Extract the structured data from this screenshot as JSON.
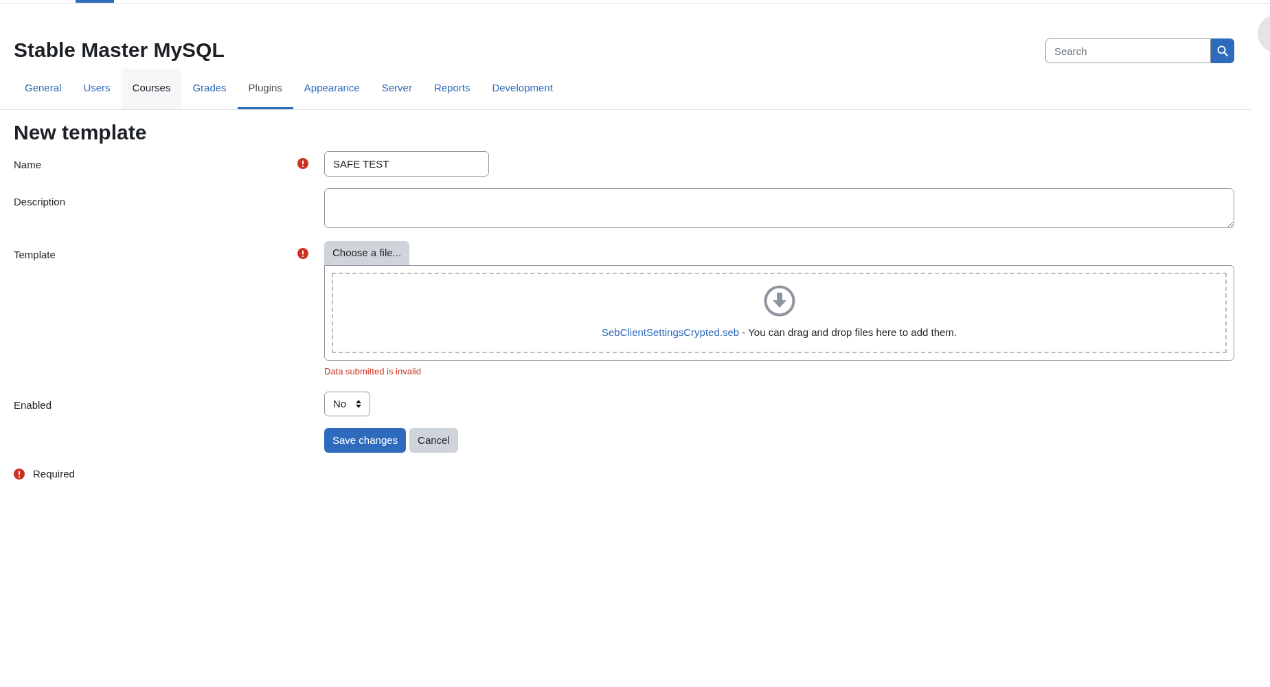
{
  "site_title": "Stable Master MySQL",
  "search": {
    "placeholder": "Search"
  },
  "tabs": [
    {
      "label": "General",
      "selected": false,
      "hovered": false
    },
    {
      "label": "Users",
      "selected": false,
      "hovered": false
    },
    {
      "label": "Courses",
      "selected": false,
      "hovered": true
    },
    {
      "label": "Grades",
      "selected": false,
      "hovered": false
    },
    {
      "label": "Plugins",
      "selected": true,
      "hovered": false
    },
    {
      "label": "Appearance",
      "selected": false,
      "hovered": false
    },
    {
      "label": "Server",
      "selected": false,
      "hovered": false
    },
    {
      "label": "Reports",
      "selected": false,
      "hovered": false
    },
    {
      "label": "Development",
      "selected": false,
      "hovered": false
    }
  ],
  "heading": "New template",
  "fields": [
    {
      "kind": "text",
      "label": "Name",
      "required": true,
      "value": "SAFE TEST"
    },
    {
      "kind": "textarea",
      "label": "Description",
      "required": false
    },
    {
      "kind": "file",
      "label": "Template",
      "required": true,
      "button": "Choose a file...",
      "file_name": "SebClientSettingsCrypted.seb",
      "hint": " - You can drag and drop files here to add them.",
      "error": "Data submitted is invalid"
    },
    {
      "kind": "select",
      "label": "Enabled",
      "required": false,
      "value": "No"
    }
  ],
  "buttons": [
    {
      "label": "Save changes",
      "kind": "primary"
    },
    {
      "label": "Cancel",
      "kind": "secondary"
    }
  ],
  "required_note": "Required"
}
